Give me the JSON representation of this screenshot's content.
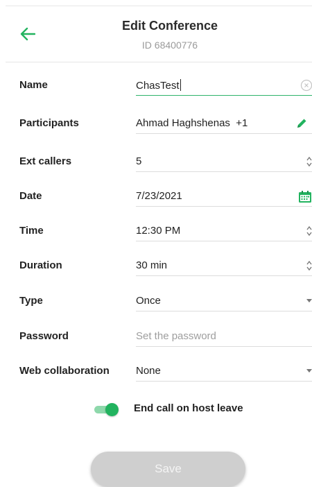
{
  "header": {
    "title": "Edit Conference",
    "subtitle": "ID 68400776"
  },
  "form": {
    "name": {
      "label": "Name",
      "value": "ChasTest"
    },
    "participants": {
      "label": "Participants",
      "value": "Ahmad Haghshenas  +1"
    },
    "ext_callers": {
      "label": "Ext callers",
      "value": "5"
    },
    "date": {
      "label": "Date",
      "value": "7/23/2021"
    },
    "time": {
      "label": "Time",
      "value": "12:30 PM"
    },
    "duration": {
      "label": "Duration",
      "value": "30 min"
    },
    "type": {
      "label": "Type",
      "value": "Once"
    },
    "password": {
      "label": "Password",
      "placeholder": "Set the password",
      "value": ""
    },
    "web_collaboration": {
      "label": "Web collaboration",
      "value": "None"
    }
  },
  "end_call_toggle": {
    "label": "End call on host leave",
    "enabled": true
  },
  "save_button": {
    "label": "Save"
  },
  "icons": {
    "back": "arrow-left-icon",
    "clear": "clear-circle-icon",
    "edit": "pencil-icon",
    "calendar": "calendar-icon",
    "stepper": "stepper-icon",
    "dropdown": "dropdown-arrow-icon"
  },
  "colors": {
    "accent": "#22b35f",
    "label": "#222222",
    "muted": "#9a9a9a",
    "disabled_button": "#cfcfcf"
  }
}
